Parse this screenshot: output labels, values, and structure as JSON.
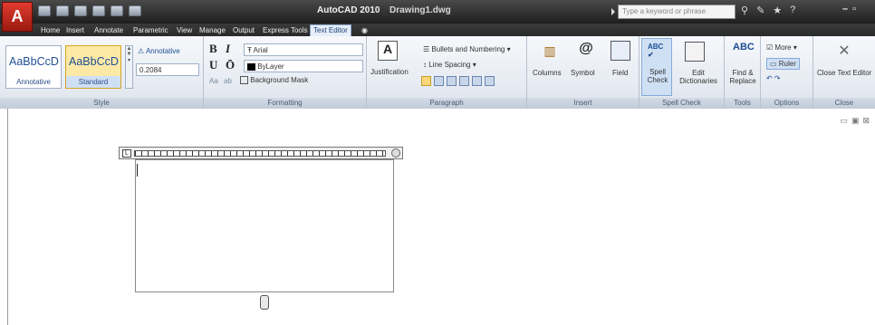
{
  "titlebar": {
    "app_title": "AutoCAD 2010",
    "file_name": "Drawing1.dwg",
    "search_placeholder": "Type a keyword or phrase",
    "logo_letter": "A"
  },
  "tabs": [
    {
      "label": "Home"
    },
    {
      "label": "Insert"
    },
    {
      "label": "Annotate"
    },
    {
      "label": "Parametric"
    },
    {
      "label": "View"
    },
    {
      "label": "Manage"
    },
    {
      "label": "Output"
    },
    {
      "label": "Express Tools"
    },
    {
      "label": "Text Editor",
      "active": true
    }
  ],
  "ribbon": {
    "style": {
      "title": "Style",
      "style1_sample": "AaBbCcD",
      "style1_name": "Annotative",
      "style2_sample": "AaBbCcD",
      "style2_name": "Standard",
      "annotative_label": "Annotative",
      "height_value": "0.2084"
    },
    "formatting": {
      "title": "Formatting",
      "bold": "B",
      "italic": "I",
      "underline": "U",
      "overline": "Ō",
      "font": "Arial",
      "color": "ByLayer",
      "case_upper": "Aa",
      "case_lower": "ab",
      "background_mask": "Background Mask"
    },
    "paragraph": {
      "title": "Paragraph",
      "justification": "Justification",
      "bullets": "Bullets and Numbering",
      "line_spacing": "Line Spacing"
    },
    "insert": {
      "title": "Insert",
      "columns": "Columns",
      "symbol": "Symbol",
      "field": "Field"
    },
    "spell_check": {
      "title": "Spell Check",
      "spell_check": "Spell Check",
      "edit_dictionaries": "Edit Dictionaries"
    },
    "tools": {
      "title": "Tools",
      "find_replace": "Find & Replace"
    },
    "options": {
      "title": "Options",
      "more": "More",
      "ruler": "Ruler"
    },
    "close": {
      "title": "Close",
      "close_text_editor": "Close Text Editor"
    }
  }
}
